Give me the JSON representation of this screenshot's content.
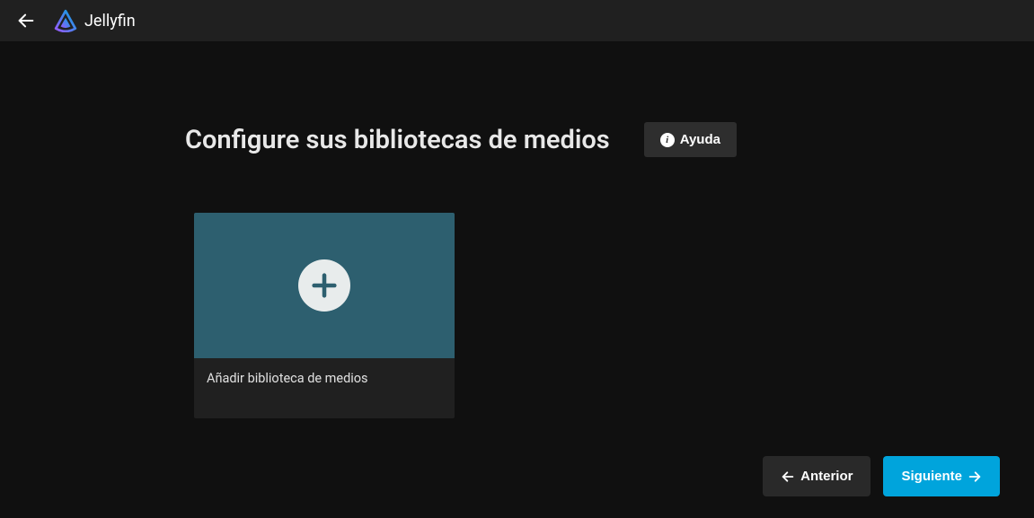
{
  "header": {
    "brand_name": "Jellyfin"
  },
  "main": {
    "title": "Configure sus bibliotecas de medios",
    "help_label": "Ayuda",
    "add_card_label": "Añadir biblioteca de medios"
  },
  "nav": {
    "previous": "Anterior",
    "next": "Siguiente"
  },
  "colors": {
    "accent": "#00a4dc",
    "card_top": "#2d5f6f"
  }
}
